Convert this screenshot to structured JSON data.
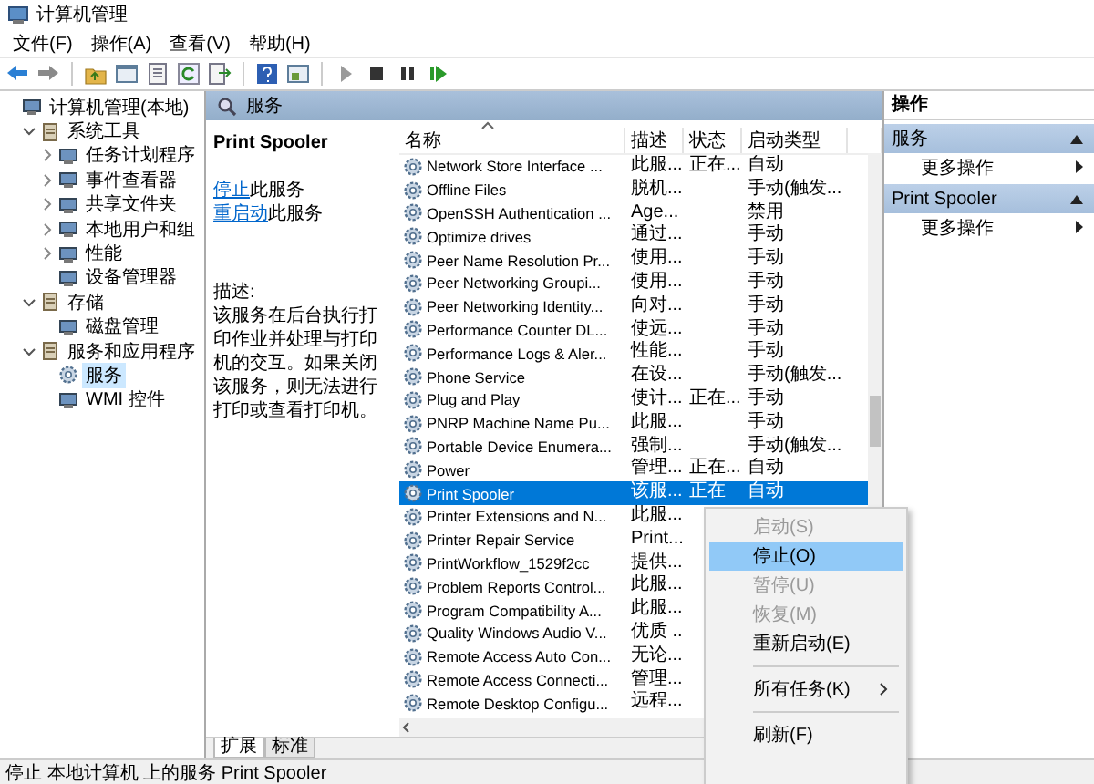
{
  "window": {
    "title": "计算机管理"
  },
  "menu": [
    "文件(F)",
    "操作(A)",
    "查看(V)",
    "帮助(H)"
  ],
  "tree": {
    "items": [
      {
        "label": "计算机管理(本地)",
        "selected": false,
        "children": [
          {
            "label": "系统工具",
            "selected": false,
            "expanded": true,
            "children": [
              {
                "label": "任务计划程序",
                "selected": false,
                "expanded": false
              },
              {
                "label": "事件查看器",
                "selected": false,
                "expanded": false
              },
              {
                "label": "共享文件夹",
                "selected": false,
                "expanded": false
              },
              {
                "label": "本地用户和组",
                "selected": false,
                "expanded": false
              },
              {
                "label": "性能",
                "selected": false,
                "expanded": false
              },
              {
                "label": "设备管理器",
                "selected": false
              }
            ]
          },
          {
            "label": "存储",
            "selected": false,
            "expanded": true,
            "children": [
              {
                "label": "磁盘管理",
                "selected": false
              }
            ]
          },
          {
            "label": "服务和应用程序",
            "selected": false,
            "expanded": true,
            "children": [
              {
                "label": "服务",
                "selected": true
              },
              {
                "label": "WMI 控件",
                "selected": false
              }
            ]
          }
        ]
      }
    ]
  },
  "center": {
    "header": "服务"
  },
  "detail": {
    "title": "Print Spooler",
    "links": [
      {
        "link": "停止",
        "text": "此服务"
      },
      {
        "link": "重启动",
        "text": "此服务"
      }
    ],
    "description_label": "描述:",
    "description": "该服务在后台执行打印作业并处理与打印机的交互。如果关闭该服务，则无法进行打印或查看打印机。"
  },
  "list": {
    "columns": [
      "名称",
      "描述",
      "状态",
      "启动类型"
    ],
    "rows": [
      {
        "name": "Network Store Interface ...",
        "description": "此服...",
        "status": "正在...",
        "startup": "自动",
        "selected": false
      },
      {
        "name": "Offline Files",
        "description": "脱机...",
        "startup": "手动(触发...",
        "selected": false
      },
      {
        "name": "OpenSSH Authentication ...",
        "description": "Age...",
        "startup": "禁用",
        "selected": false
      },
      {
        "name": "Optimize drives",
        "description": "通过...",
        "startup": "手动",
        "selected": false
      },
      {
        "name": "Peer Name Resolution Pr...",
        "description": "使用...",
        "startup": "手动",
        "selected": false
      },
      {
        "name": "Peer Networking Groupi...",
        "description": "使用...",
        "startup": "手动",
        "selected": false
      },
      {
        "name": "Peer Networking Identity...",
        "description": "向对...",
        "startup": "手动",
        "selected": false
      },
      {
        "name": "Performance Counter DL...",
        "description": "使远...",
        "startup": "手动",
        "selected": false
      },
      {
        "name": "Performance Logs & Aler...",
        "description": "性能...",
        "startup": "手动",
        "selected": false
      },
      {
        "name": "Phone Service",
        "description": "在设...",
        "startup": "手动(触发...",
        "selected": false
      },
      {
        "name": "Plug and Play",
        "description": "使计...",
        "status": "正在...",
        "startup": "手动",
        "selected": false
      },
      {
        "name": "PNRP Machine Name Pu...",
        "description": "此服...",
        "startup": "手动",
        "selected": false
      },
      {
        "name": "Portable Device Enumera...",
        "description": "强制...",
        "startup": "手动(触发...",
        "selected": false
      },
      {
        "name": "Power",
        "description": "管理...",
        "status": "正在...",
        "startup": "自动",
        "selected": false
      },
      {
        "name": "Print Spooler",
        "description": "该服...",
        "status": "正在",
        "startup": "自动",
        "selected": true
      },
      {
        "name": "Printer Extensions and N...",
        "description": "此服...",
        "selected": false
      },
      {
        "name": "Printer Repair Service",
        "description": "Print...",
        "selected": false
      },
      {
        "name": "PrintWorkflow_1529f2cc",
        "description": "提供...",
        "selected": false
      },
      {
        "name": "Problem Reports Control...",
        "description": "此服...",
        "selected": false
      },
      {
        "name": "Program Compatibility A...",
        "description": "此服...",
        "selected": false
      },
      {
        "name": "Quality Windows Audio V...",
        "description": "优质 ...",
        "selected": false
      },
      {
        "name": "Remote Access Auto Con...",
        "description": "无论...",
        "selected": false
      },
      {
        "name": "Remote Access Connecti...",
        "description": "管理...",
        "selected": false
      },
      {
        "name": "Remote Desktop Configu...",
        "description": "远程...",
        "selected": false
      }
    ]
  },
  "tabs": [
    {
      "label": "扩展",
      "selected": true
    },
    {
      "label": "标准",
      "selected": false
    }
  ],
  "actions": {
    "title": "操作",
    "sections": [
      {
        "label": "服务",
        "items": [
          "更多操作"
        ]
      },
      {
        "label": "Print Spooler",
        "items": [
          "更多操作"
        ]
      }
    ]
  },
  "context_menu": [
    {
      "kind": "item",
      "label": "启动(S)",
      "disabled": true,
      "selected": false,
      "submenu": false
    },
    {
      "kind": "item",
      "label": "停止(O)",
      "disabled": false,
      "selected": true,
      "submenu": false
    },
    {
      "kind": "item",
      "label": "暂停(U)",
      "disabled": true,
      "selected": false,
      "submenu": false
    },
    {
      "kind": "item",
      "label": "恢复(M)",
      "disabled": true,
      "selected": false,
      "submenu": false
    },
    {
      "kind": "item",
      "label": "重新启动(E)",
      "disabled": false,
      "selected": false,
      "submenu": false
    },
    {
      "kind": "separator"
    },
    {
      "kind": "item",
      "label": "所有任务(K)",
      "disabled": false,
      "selected": false,
      "submenu": true
    },
    {
      "kind": "separator"
    },
    {
      "kind": "item",
      "label": "刷新(F)",
      "disabled": false,
      "selected": false,
      "submenu": false
    }
  ],
  "status_bar": "停止 本地计算机 上的服务 Print Spooler"
}
